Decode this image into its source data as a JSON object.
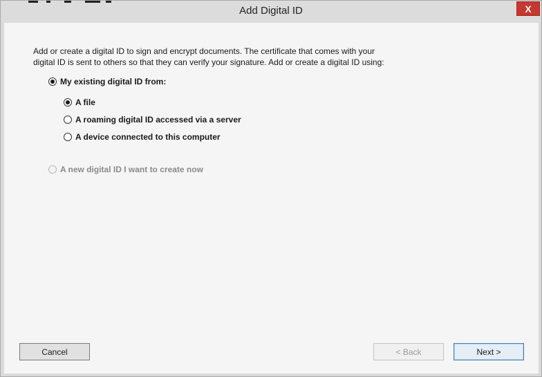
{
  "window": {
    "title": "Add Digital ID",
    "close_glyph": "X"
  },
  "intro": {
    "text": "Add or create a digital ID to sign and encrypt documents. The certificate that comes with your digital ID is sent to others so that they can verify your signature. Add or create a digital ID using:"
  },
  "options": {
    "existing": {
      "label": "My existing digital ID from:",
      "selected": true,
      "enabled": true
    },
    "file": {
      "label": "A file",
      "selected": true,
      "enabled": true
    },
    "roaming": {
      "label": "A roaming digital ID accessed via a server",
      "selected": false,
      "enabled": true
    },
    "device": {
      "label": "A device connected to this computer",
      "selected": false,
      "enabled": true
    },
    "create_new": {
      "label": "A new digital ID I want to create now",
      "selected": false,
      "enabled": false
    }
  },
  "buttons": {
    "cancel": "Cancel",
    "back": "< Back",
    "next": "Next >"
  },
  "colors": {
    "close_button": "#c7372f",
    "default_button_border": "#3c7fb1",
    "disabled_text": "#8a8a8a"
  }
}
